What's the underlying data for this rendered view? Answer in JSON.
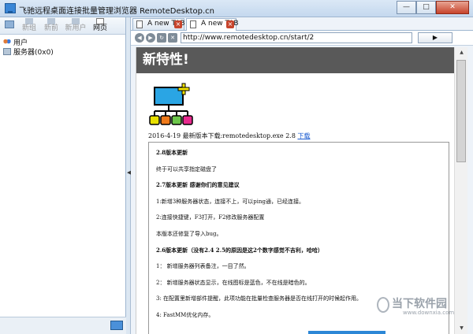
{
  "window": {
    "title": "飞驰远程桌面连接批量管理浏览器 RemoteDesktop.cn",
    "min": "—",
    "max": "□",
    "close": "✕"
  },
  "toolbar": {
    "items": [
      "新组",
      "新前",
      "新用户",
      "网页"
    ]
  },
  "tree": {
    "items": [
      {
        "label": "用户",
        "icon": "users-icon"
      },
      {
        "label": "服务器(0x0)",
        "icon": "server-icon"
      }
    ]
  },
  "tabs": [
    {
      "label": "A new TAB",
      "active": false
    },
    {
      "label": "A new TAB",
      "active": true
    }
  ],
  "navbar": {
    "back": "◀",
    "forward": "▶",
    "refresh": "↻",
    "stop": "✕",
    "url": "http://www.remotedesktop.cn/start/2",
    "go": "▶"
  },
  "page": {
    "banner": "新特性!",
    "release_text": "2016-4-19 最新版本下载:remotedesktop.exe 2.8",
    "release_link": "下载",
    "notes": [
      {
        "text": "2.8版本更新",
        "bold": true
      },
      {
        "text": "终于可以共享指定磁盘了",
        "bold": false
      },
      {
        "text": "2.7版本更新  感谢你们的意见建议",
        "bold": true
      },
      {
        "text": "1:新增3种服务器状态，连接不上，可以ping通，已经连接。",
        "bold": false
      },
      {
        "text": "2:连接快捷键，F3打开，F2修改服务器配置",
        "bold": false
      },
      {
        "text": "本版本还修复了导入bug。",
        "bold": false
      },
      {
        "text": "2.6版本更新（没有2.4 2.5的原因是这2个数字感觉不吉利，哈哈）",
        "bold": true
      },
      {
        "text": "1：  新增服务器列表备注，一目了然。",
        "bold": false
      },
      {
        "text": "2：  新增服务器状态显示，在线图标是蓝色，不在线是暗色的。",
        "bold": false
      },
      {
        "text": "3: 在配置里新增部件提醒，此项功能在批量检查服务器是否在线打开的时候起作用。",
        "bold": false
      },
      {
        "text": "4:   FastMM优化内存。",
        "bold": false
      }
    ]
  },
  "watermark": {
    "main": "当下软件园",
    "url": "www.downxia.com"
  }
}
